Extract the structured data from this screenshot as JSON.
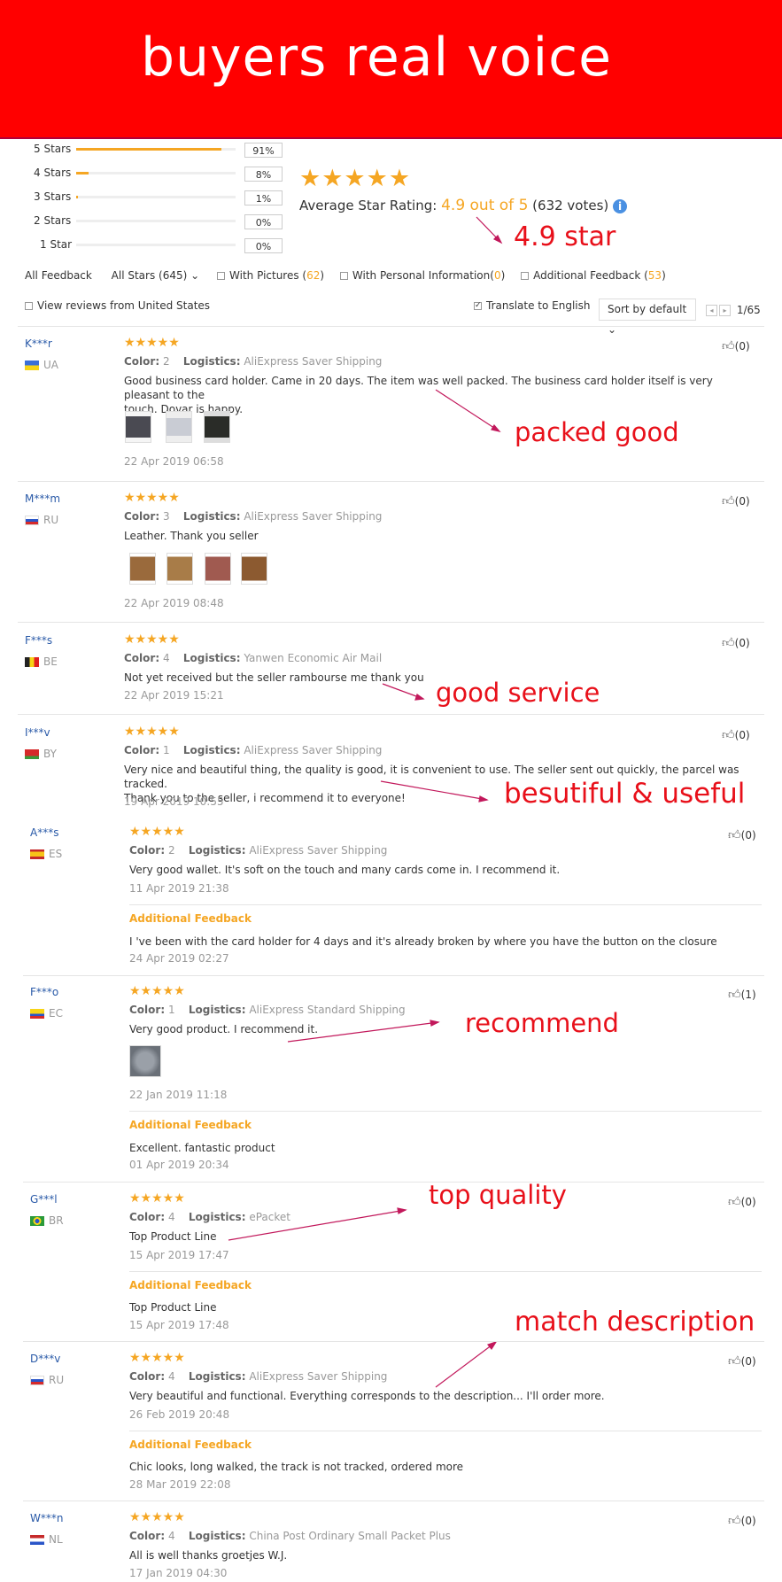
{
  "banner": {
    "title": "buyers real voice"
  },
  "rating_rows": [
    {
      "label": "5 Stars",
      "fraction": 0.91,
      "pct": "91%"
    },
    {
      "label": "4 Stars",
      "fraction": 0.08,
      "pct": "8%"
    },
    {
      "label": "3 Stars",
      "fraction": 0.01,
      "pct": "1%"
    },
    {
      "label": "2 Stars",
      "fraction": 0.0,
      "pct": "0%"
    },
    {
      "label": "1 Star",
      "fraction": 0.0,
      "pct": "0%"
    }
  ],
  "summary": {
    "stars": "★★★★★",
    "avg_label": "Average Star Rating:",
    "avg_value": "4.9 out of 5",
    "votes": "(632 votes)",
    "info": "i"
  },
  "annotations": {
    "star": "4.9 star",
    "packed": "packed good",
    "service": "good service",
    "beautiful": "besutiful & useful",
    "recommend": "recommend",
    "quality": "top quality",
    "match": "match description"
  },
  "filters": {
    "all_feedback": "All Feedback",
    "all_stars": "All Stars (645)",
    "with_pictures": "With Pictures (",
    "with_pictures_count": "62",
    "personal_info": "With Personal Information(",
    "personal_info_count": "0",
    "additional": "Additional Feedback (",
    "additional_count": "53",
    "close_paren": ")"
  },
  "toolbar": {
    "view_us": "View reviews from United States",
    "translate": "Translate to English",
    "sort": "Sort by default",
    "page": "1/65"
  },
  "labels": {
    "color": "Color:",
    "logistics": "Logistics:",
    "additional_feedback": "Additional Feedback"
  },
  "reviews": [
    {
      "user": "K***r",
      "country": "UA",
      "stars": "★★★★★",
      "color": "2",
      "logistics": "AliExpress Saver Shipping",
      "text1": "Good business card holder. Came in 20 days. The item was well packed. The business card holder itself is very pleasant to the",
      "text2": "touch. Dovar is happy.",
      "date": "22 Apr 2019 06:58",
      "likes": "(0)"
    },
    {
      "user": "M***m",
      "country": "RU",
      "stars": "★★★★★",
      "color": "3",
      "logistics": "AliExpress Saver Shipping",
      "text1": "Leather. Thank you seller",
      "date": "22 Apr 2019 08:48",
      "likes": "(0)"
    },
    {
      "user": "F***s",
      "country": "BE",
      "stars": "★★★★★",
      "color": "4",
      "logistics": "Yanwen Economic Air Mail",
      "text1": "Not yet received but the seller rambourse me thank you",
      "date": "22 Apr 2019 15:21",
      "likes": "(0)"
    },
    {
      "user": "I***v",
      "country": "BY",
      "stars": "★★★★★",
      "color": "1",
      "logistics": "AliExpress Saver Shipping",
      "text1": "Very nice and beautiful thing, the quality is good, it is convenient to use. The seller sent out quickly, the parcel was tracked.",
      "text2": "Thank you to the seller, i recommend it to everyone!",
      "date": "19 Apr 2019 10:55",
      "likes": "(0)"
    },
    {
      "user": "A***s",
      "country": "ES",
      "stars": "★★★★★",
      "color": "2",
      "logistics": "AliExpress Saver Shipping",
      "text1": "Very good wallet. It's soft on the touch and many cards come in. I recommend it.",
      "date": "11 Apr 2019 21:38",
      "add_text": "I 've been with the card holder for 4 days and it's already broken by where you have the button on the closure",
      "add_date": "24 Apr 2019 02:27",
      "likes": "(0)"
    },
    {
      "user": "F***o",
      "country": "EC",
      "stars": "★★★★★",
      "color": "1",
      "logistics": "AliExpress Standard Shipping",
      "text1": "Very good product. I recommend it.",
      "date": "22 Jan 2019 11:18",
      "add_text": "Excellent. fantastic product",
      "add_date": "01 Apr 2019 20:34",
      "likes": "(1)"
    },
    {
      "user": "G***l",
      "country": "BR",
      "stars": "★★★★★",
      "color": "4",
      "logistics": "ePacket",
      "text1": "Top Product Line",
      "date": "15 Apr 2019 17:47",
      "add_text": "Top Product Line",
      "add_date": "15 Apr 2019 17:48",
      "likes": "(0)"
    },
    {
      "user": "D***v",
      "country": "RU",
      "stars": "★★★★★",
      "color": "4",
      "logistics": "AliExpress Saver Shipping",
      "text1": "Very beautiful and functional. Everything corresponds to the description... I'll order more.",
      "date": "26 Feb 2019 20:48",
      "add_text": "Chic looks, long walked, the track is not tracked, ordered more",
      "add_date": "28 Mar 2019 22:08",
      "likes": "(0)"
    },
    {
      "user": "W***n",
      "country": "NL",
      "stars": "★★★★★",
      "color": "4",
      "logistics": "China Post Ordinary Small Packet Plus",
      "text1": "All is well thanks groetjes W.J.",
      "date": "17 Jan 2019 04:30",
      "likes": "(0)"
    }
  ],
  "colors": {
    "banner": "#ff0000",
    "accent": "#f5a623",
    "annotation": "#e8101a",
    "username": "#2a5aa8"
  }
}
